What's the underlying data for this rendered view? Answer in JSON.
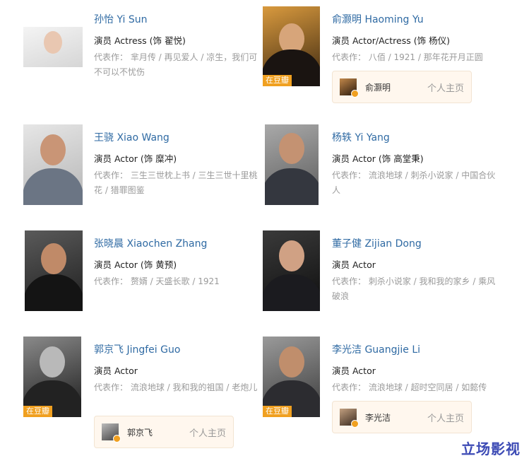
{
  "people": [
    {
      "name": "孙怡 Yi Sun",
      "role": "演员 Actress (饰 翟悦)",
      "works_label": "代表作：",
      "works": "芈月传 / 再见爱人 / 凉生，我们可不可以不忧伤"
    },
    {
      "name": "俞灏明 Haoming Yu",
      "role": "演员 Actor/Actress (饰 杨仪)",
      "works_label": "代表作：",
      "works": "八佰 / 1921 / 那年花开月正圆",
      "tag": "在豆瓣",
      "home": {
        "name": "俞灏明",
        "link": "个人主页"
      }
    },
    {
      "name": "王骁 Xiao Wang",
      "role": "演员 Actor (饰 糜冲)",
      "works_label": "代表作：",
      "works": "三生三世枕上书 / 三生三世十里桃花 / 猎罪图鉴"
    },
    {
      "name": "杨轶 Yi Yang",
      "role": "演员 Actor (饰 高堂秉)",
      "works_label": "代表作：",
      "works": "流浪地球 / 刺杀小说家 / 中国合伙人"
    },
    {
      "name": "张晓晨 Xiaochen Zhang",
      "role": "演员 Actor (饰 黄预)",
      "works_label": "代表作：",
      "works": "赘婿 / 天盛长歌 / 1921"
    },
    {
      "name": "董子健 Zijian Dong",
      "role": "演员 Actor",
      "works_label": "代表作：",
      "works": "刺杀小说家 / 我和我的家乡 / 乘风破浪"
    },
    {
      "name": "郭京飞 Jingfei Guo",
      "role": "演员 Actor",
      "works_label": "代表作：",
      "works": "流浪地球 / 我和我的祖国 / 老炮儿",
      "tag": "在豆瓣",
      "home": {
        "name": "郭京飞",
        "link": "个人主页"
      }
    },
    {
      "name": "李光洁 Guangjie Li",
      "role": "演员 Actor",
      "works_label": "代表作：",
      "works": "流浪地球 / 超时空同居 / 如懿传",
      "tag": "在豆瓣",
      "home": {
        "name": "李光洁",
        "link": "个人主页"
      }
    }
  ],
  "watermark": "立场影视"
}
